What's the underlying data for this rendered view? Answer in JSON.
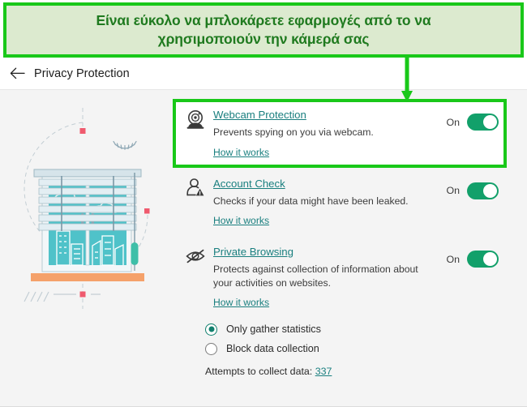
{
  "annotation": {
    "banner_text": "Είναι εύκολο να μπλοκάρετε εφαρμογές από το να\nχρησιμοποιούν την κάμερά σας",
    "banner_fill": "#dceacf",
    "banner_border": "#19c819",
    "arrow_color": "#19c819",
    "highlight_color": "#19c819",
    "highlight_target": "webcam-protection"
  },
  "header": {
    "back_icon": "arrow-left-icon",
    "title": "Privacy Protection"
  },
  "illustration": {
    "name": "window-blinds-illustration",
    "colors": {
      "blind": "#cfe0e8",
      "glass": "#4fc2c9",
      "sill": "#f5a16a",
      "marker": "#ef5a6e",
      "outline": "#5a7d8c"
    }
  },
  "features": [
    {
      "id": "webcam-protection",
      "icon": "webcam-icon",
      "title": "Webcam Protection",
      "description": "Prevents spying on you via webcam.",
      "link": "How it works",
      "toggle_label": "On",
      "toggle_state": "on",
      "highlighted": true
    },
    {
      "id": "account-check",
      "icon": "user-warning-icon",
      "title": "Account Check",
      "description": "Checks if your data might have been leaked.",
      "link": "How it works",
      "toggle_label": "On",
      "toggle_state": "on",
      "highlighted": false
    },
    {
      "id": "private-browsing",
      "icon": "eye-slash-icon",
      "title": "Private Browsing",
      "description": "Protects against collection of information about your activities on websites.",
      "link": "How it works",
      "toggle_label": "On",
      "toggle_state": "on",
      "highlighted": false
    }
  ],
  "options": {
    "radios": [
      {
        "label": "Only gather statistics",
        "checked": true
      },
      {
        "label": "Block data collection",
        "checked": false
      }
    ],
    "attempts_label": "Attempts to collect data:",
    "attempts_count": "337"
  },
  "colors": {
    "accent_link": "#1a7f7f",
    "toggle_on": "#12a06a",
    "content_bg": "#f4f4f4"
  }
}
